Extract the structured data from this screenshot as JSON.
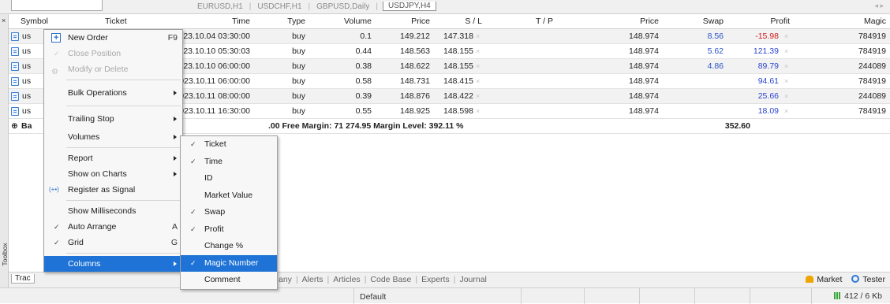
{
  "chart_tabs": {
    "items": [
      "EURUSD,H1",
      "USDCHF,H1",
      "GBPUSD,Daily",
      "USDJPY,H4"
    ],
    "active_index": 3
  },
  "rail": {
    "close": "×",
    "label": "Toolbox"
  },
  "table": {
    "headers": [
      "Symbol",
      "Ticket",
      "Time",
      "Type",
      "Volume",
      "Price",
      "S / L",
      "T / P",
      "Price",
      "Swap",
      "Profit",
      "Magic"
    ],
    "rows": [
      {
        "symbol": "us",
        "time": "2023.10.04 03:30:00",
        "type": "buy",
        "volume": "0.1",
        "price": "149.212",
        "sl": "147.318",
        "tp": "",
        "cur_price": "148.974",
        "swap": "8.56",
        "profit": "-15.98",
        "magic": "784919"
      },
      {
        "symbol": "us",
        "time": "2023.10.10 05:30:03",
        "type": "buy",
        "volume": "0.44",
        "price": "148.563",
        "sl": "148.155",
        "tp": "",
        "cur_price": "148.974",
        "swap": "5.62",
        "profit": "121.39",
        "magic": "784919"
      },
      {
        "symbol": "us",
        "time": "2023.10.10 06:00:00",
        "type": "buy",
        "volume": "0.38",
        "price": "148.622",
        "sl": "148.155",
        "tp": "",
        "cur_price": "148.974",
        "swap": "4.86",
        "profit": "89.79",
        "magic": "244089"
      },
      {
        "symbol": "us",
        "time": "2023.10.11 06:00:00",
        "type": "buy",
        "volume": "0.58",
        "price": "148.731",
        "sl": "148.415",
        "tp": "",
        "cur_price": "148.974",
        "swap": "",
        "profit": "94.61",
        "magic": "784919"
      },
      {
        "symbol": "us",
        "time": "2023.10.11 08:00:00",
        "type": "buy",
        "volume": "0.39",
        "price": "148.876",
        "sl": "148.422",
        "tp": "",
        "cur_price": "148.974",
        "swap": "",
        "profit": "25.66",
        "magic": "244089"
      },
      {
        "symbol": "us",
        "time": "2023.10.11 16:30:00",
        "type": "buy",
        "volume": "0.55",
        "price": "148.925",
        "sl": "148.598",
        "tp": "",
        "cur_price": "148.974",
        "swap": "",
        "profit": "18.09",
        "magic": "784919"
      }
    ],
    "summary": {
      "prefix": "Ba",
      "text": ".00  Free Margin: 71 274.95  Margin Level: 392.11 %",
      "total": "352.60"
    },
    "close_mark": "×"
  },
  "context_menu": {
    "items": [
      {
        "label": "New Order",
        "shortcut": "F9"
      },
      {
        "label": "Close Position"
      },
      {
        "label": "Modify or Delete"
      },
      {
        "label": "Bulk Operations"
      },
      {
        "label": "Trailing Stop"
      },
      {
        "label": "Volumes"
      },
      {
        "label": "Report"
      },
      {
        "label": "Show on Charts"
      },
      {
        "label": "Register as Signal"
      },
      {
        "label": "Show Milliseconds"
      },
      {
        "label": "Auto Arrange",
        "shortcut": "A"
      },
      {
        "label": "Grid",
        "shortcut": "G"
      },
      {
        "label": "Columns"
      }
    ],
    "signal_icon": "(+•)"
  },
  "columns_menu": {
    "items": [
      {
        "label": "Ticket",
        "checked": true
      },
      {
        "label": "Time",
        "checked": true
      },
      {
        "label": "ID",
        "checked": false
      },
      {
        "label": "Market Value",
        "checked": false
      },
      {
        "label": "Swap",
        "checked": true
      },
      {
        "label": "Profit",
        "checked": true
      },
      {
        "label": "Change %",
        "checked": false
      },
      {
        "label": "Magic Number",
        "checked": true
      },
      {
        "label": "Comment",
        "checked": false
      }
    ],
    "check_glyph": "✓"
  },
  "bottom_tabs": {
    "trade": "Trac",
    "items": [
      "any",
      "Alerts",
      "Articles",
      "Code Base",
      "Experts",
      "Journal"
    ],
    "market": "Market",
    "tester": "Tester"
  },
  "status": {
    "profile": "Default",
    "traffic": "412 / 6 Kb"
  },
  "colors": {
    "highlight": "#1f73d6",
    "profit_negative": "#d01919",
    "profit_positive": "#2b44d0",
    "swap": "#2b55c7"
  }
}
